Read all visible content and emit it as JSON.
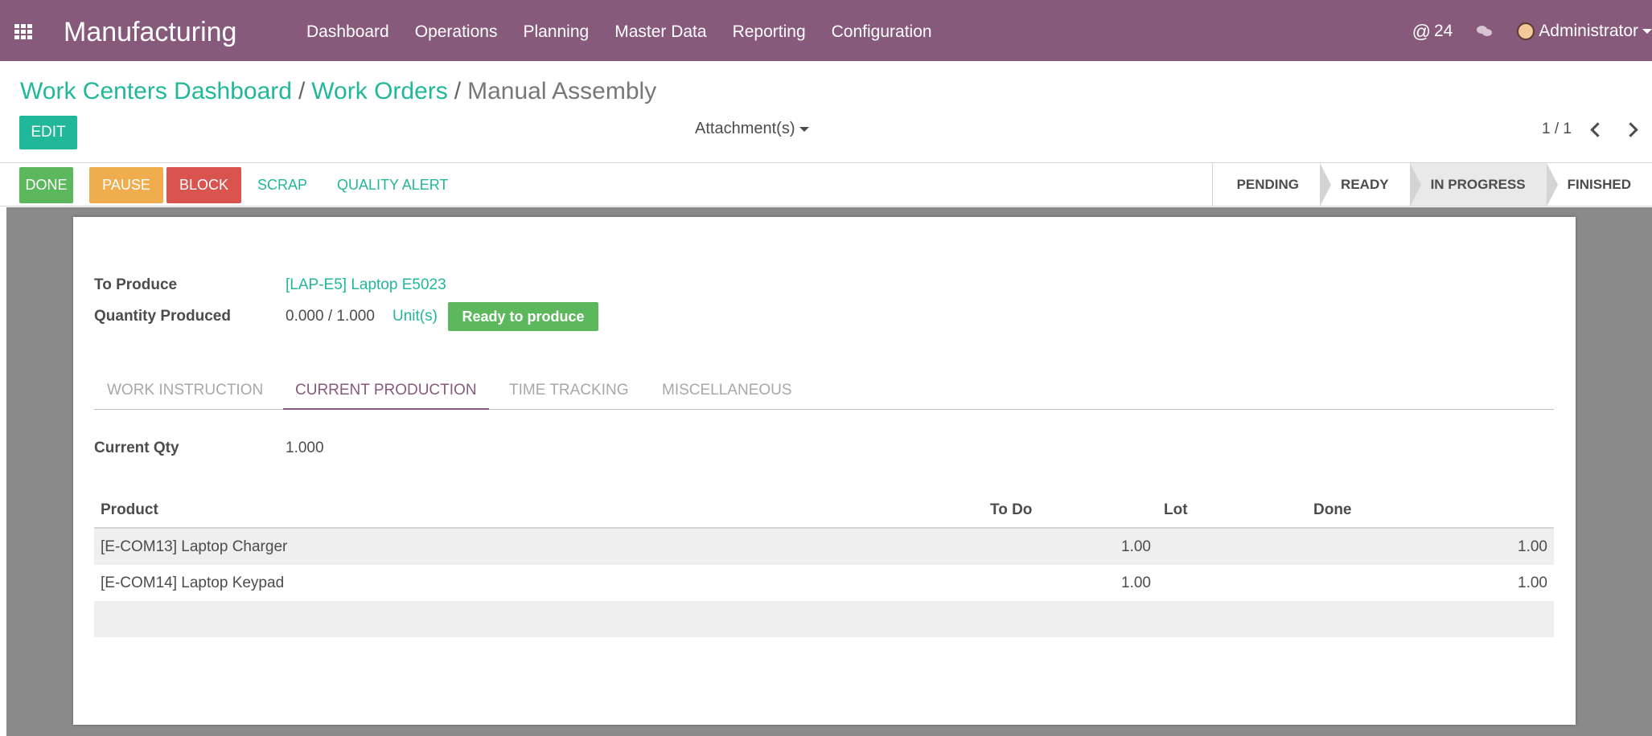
{
  "app": {
    "name": "Manufacturing",
    "menu": [
      "Dashboard",
      "Operations",
      "Planning",
      "Master Data",
      "Reporting",
      "Configuration"
    ],
    "messages_count": "24",
    "user": "Administrator"
  },
  "breadcrumb": {
    "items": [
      "Work Centers Dashboard",
      "Work Orders"
    ],
    "current": "Manual Assembly"
  },
  "controls": {
    "edit_label": "EDIT",
    "attachments_label": "Attachment(s)",
    "pager": "1 / 1"
  },
  "actions": {
    "done": "DONE",
    "pause": "PAUSE",
    "block": "BLOCK",
    "scrap": "SCRAP",
    "quality_alert": "QUALITY ALERT"
  },
  "stages": [
    "PENDING",
    "READY",
    "IN PROGRESS",
    "FINISHED"
  ],
  "current_stage": "IN PROGRESS",
  "form": {
    "to_produce_label": "To Produce",
    "to_produce_value": "[LAP-E5] Laptop E5023",
    "qty_label": "Quantity Produced",
    "qty_value": "0.000 / 1.000",
    "qty_uom": "Unit(s)",
    "state_badge": "Ready to produce",
    "current_qty_label": "Current Qty",
    "current_qty_value": "1.000"
  },
  "tabs": [
    "WORK INSTRUCTION",
    "CURRENT PRODUCTION",
    "TIME TRACKING",
    "MISCELLANEOUS"
  ],
  "active_tab": "CURRENT PRODUCTION",
  "lines_table": {
    "headers": [
      "Product",
      "To Do",
      "Lot",
      "Done"
    ],
    "rows": [
      {
        "product": "[E-COM13] Laptop Charger",
        "todo": "1.00",
        "lot": "",
        "done": "1.00"
      },
      {
        "product": "[E-COM14] Laptop Keypad",
        "todo": "1.00",
        "lot": "",
        "done": "1.00"
      }
    ]
  },
  "colors": {
    "brand": "#875a7b",
    "accent": "#21b799",
    "success": "#5cb85c",
    "warning": "#f0ad4e",
    "danger": "#d9534f"
  }
}
